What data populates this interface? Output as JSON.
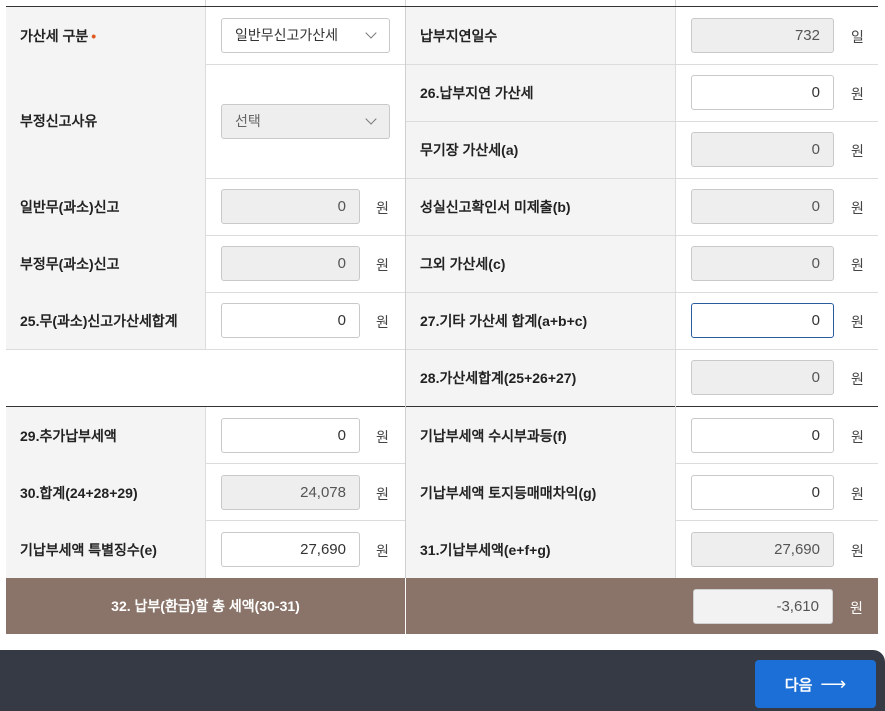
{
  "left": {
    "penalty_type": {
      "label": "가산세 구분",
      "required_mark": "•",
      "value": "일반무신고가산세"
    },
    "fraud_reason": {
      "label": "부정신고사유",
      "value": "선택"
    },
    "general_unreported": {
      "label": "일반무(과소)신고",
      "value": "0",
      "unit": "원"
    },
    "fraud_unreported": {
      "label": "부정무(과소)신고",
      "value": "0",
      "unit": "원"
    },
    "line25": {
      "label": "25.무(과소)신고가산세합계",
      "value": "0",
      "unit": "원"
    },
    "line29": {
      "label": "29.추가납부세액",
      "value": "0",
      "unit": "원"
    },
    "line30": {
      "label": "30.합계(24+28+29)",
      "value": "24,078",
      "unit": "원"
    },
    "special_collection": {
      "label": "기납부세액 특별징수(e)",
      "value": "27,690",
      "unit": "원"
    }
  },
  "right": {
    "late_days": {
      "label": "납부지연일수",
      "value": "732",
      "unit": "일"
    },
    "line26": {
      "label": "26.납부지연 가산세",
      "value": "0",
      "unit": "원"
    },
    "no_bookkeeping": {
      "label": "무기장 가산세(a)",
      "value": "0",
      "unit": "원"
    },
    "sincerity_report": {
      "label": "성실신고확인서 미제출(b)",
      "value": "0",
      "unit": "원"
    },
    "other": {
      "label": "그외 가산세(c)",
      "value": "0",
      "unit": "원"
    },
    "line27": {
      "label": "27.기타 가산세 합계(a+b+c)",
      "value": "0",
      "unit": "원"
    },
    "line28": {
      "label": "28.가산세합계(25+26+27)",
      "value": "0",
      "unit": "원"
    },
    "occasional": {
      "label": "기납부세액 수시부과등(f)",
      "value": "0",
      "unit": "원"
    },
    "land_trade": {
      "label": "기납부세액 토지등매매차익(g)",
      "value": "0",
      "unit": "원"
    },
    "line31": {
      "label": "31.기납부세액(e+f+g)",
      "value": "27,690",
      "unit": "원"
    }
  },
  "total": {
    "label": "32. 납부(환급)할 총 세액(30-31)",
    "value": "-3,610",
    "unit": "원"
  },
  "footer": {
    "next_label": "다음",
    "next_arrow": "⟶"
  },
  "colors": {
    "total_bar": "#8a7469",
    "footer_bg": "#363a45",
    "next_button": "#1c6fd6",
    "required_mark": "#e05a1e"
  }
}
